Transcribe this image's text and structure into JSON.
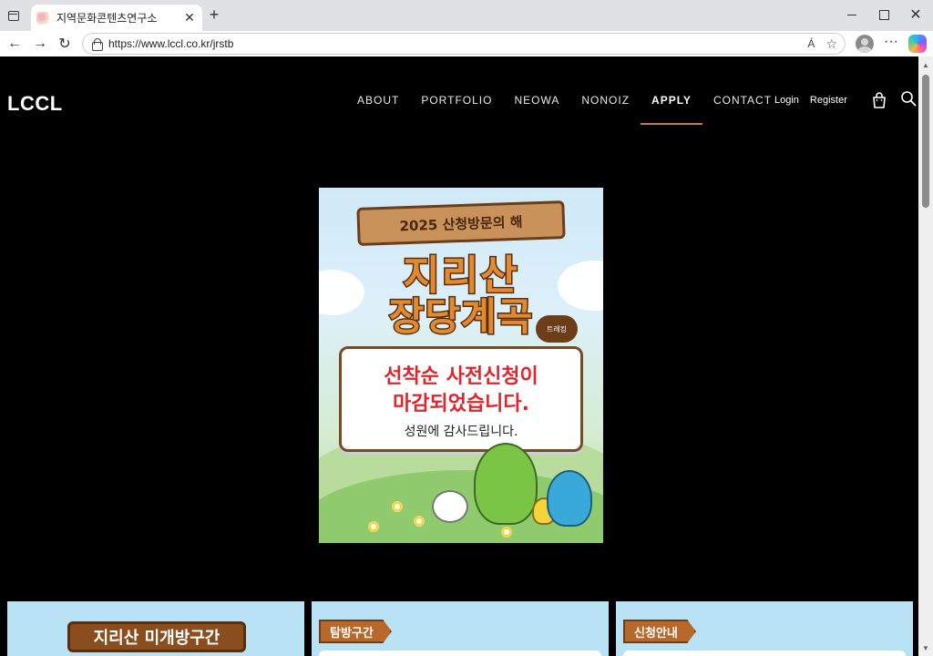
{
  "browser": {
    "tab_title": "지역문화콘텐츠연구소",
    "url": "https://www.lccl.co.kr/jrstb",
    "read_aloud_label": "Á"
  },
  "site": {
    "logo": "LCCL",
    "menu": [
      "ABOUT",
      "PORTFOLIO",
      "NEOWA",
      "NONOIZ",
      "APPLY",
      "CONTACT"
    ],
    "active_menu": "APPLY",
    "auth": {
      "login": "Login",
      "register": "Register"
    }
  },
  "poster": {
    "ribbon": "2025 산청방문의 해",
    "headline_1": "지리산",
    "headline_2": "장당계곡",
    "badge": "트레킹",
    "notice_line_1": "선착순 사전신청이",
    "notice_line_2": "마감되었습니다.",
    "notice_line_3": "성원에 감사드립니다."
  },
  "cards": {
    "card1_title": "지리산 미개방구간",
    "card2_tag": "탐방구간",
    "card3_tag": "신청안내"
  },
  "icons": {
    "tab_toggle": "tab-actions-icon",
    "bag": "shopping-bag-icon",
    "search": "search-icon"
  },
  "colors": {
    "page_bg": "#000000",
    "active_underline": "#c97a3a",
    "poster_red": "#e0262c",
    "card_bg": "#b9e2f4"
  }
}
